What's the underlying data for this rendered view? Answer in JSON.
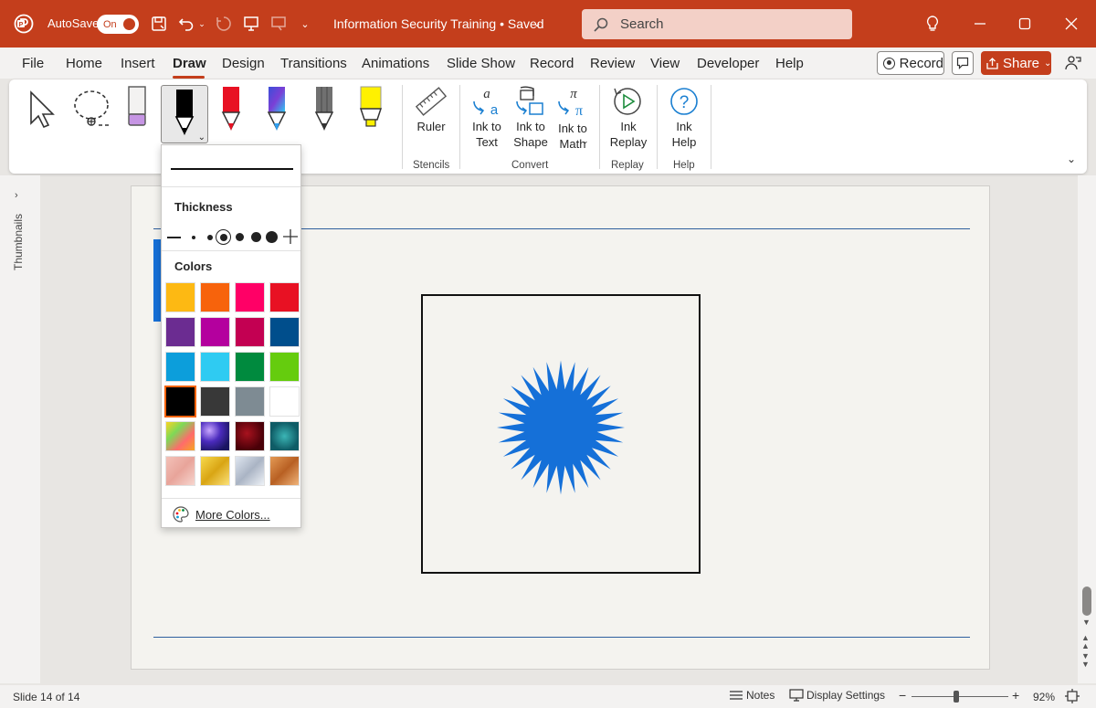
{
  "titlebar": {
    "autosave_label": "AutoSave",
    "autosave_state": "On",
    "doc_title": "Information Security Training • Saved",
    "search_placeholder": "Search",
    "accent_color": "#c43e1c"
  },
  "menu": {
    "tabs": [
      "File",
      "Home",
      "Insert",
      "Draw",
      "Design",
      "Transitions",
      "Animations",
      "Slide Show",
      "Record",
      "Review",
      "View",
      "Developer",
      "Help"
    ],
    "active_tab": "Draw",
    "record_label": "Record",
    "share_label": "Share"
  },
  "ribbon": {
    "tools": [
      "select-icon",
      "lasso-icon",
      "eraser-icon",
      "black-pen-icon",
      "red-pen-icon",
      "galaxy-pen-icon",
      "pencil-icon",
      "highlighter-icon"
    ],
    "ruler_label": "Ruler",
    "ink_to_text_label": "Ink to\nText",
    "ink_to_shape_label": "Ink to\nShape",
    "ink_to_math_label": "Ink to\nMath",
    "ink_replay_label": "Ink\nReplay",
    "ink_help_label": "Ink\nHelp",
    "groups": {
      "stencils": "Stencils",
      "convert": "Convert",
      "replay": "Replay",
      "help": "Help"
    }
  },
  "pen_popup": {
    "thickness_label": "Thickness",
    "colors_label": "Colors",
    "more_colors_label": "More Colors...",
    "color_rows": [
      [
        "#fdb913",
        "#f7630c",
        "#ff0066",
        "#e81123"
      ],
      [
        "#6b2c91",
        "#b4009e",
        "#c30052",
        "#004e8c"
      ],
      [
        "#0c9edb",
        "#2fcbf2",
        "#008a3e",
        "#65cc0e"
      ],
      [
        "#000000",
        "#383838",
        "#7e8b93",
        "#ffffff"
      ]
    ],
    "texture_rows": [
      [
        "rainbow",
        "galaxy",
        "lava",
        "ocean"
      ],
      [
        "rose-gold",
        "gold",
        "silver",
        "bronze"
      ]
    ],
    "selected_color": "#000000"
  },
  "left_rail": {
    "thumbnails_label": "Thumbnails"
  },
  "slide": {
    "shape_color": "#1570d8"
  },
  "status": {
    "slide_info": "Slide 14 of 14",
    "notes_label": "Notes",
    "display_settings_label": "Display Settings",
    "zoom": "92%"
  }
}
